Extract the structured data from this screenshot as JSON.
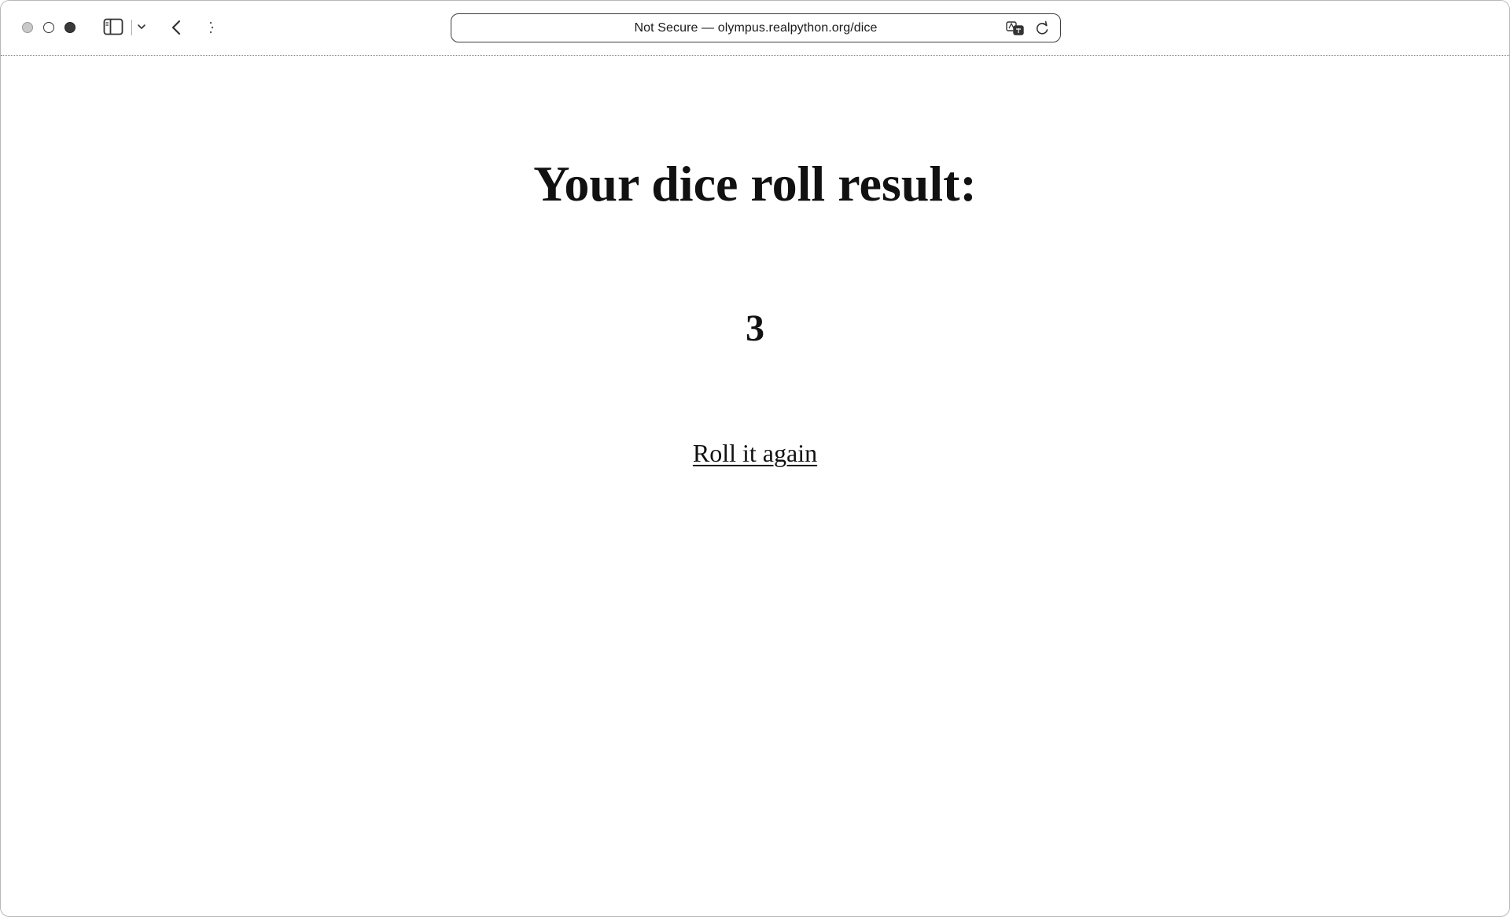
{
  "browser": {
    "address_bar": "Not Secure — olympus.realpython.org/dice"
  },
  "page": {
    "heading": "Your dice roll result:",
    "result": "3",
    "link_label": "Roll it again"
  },
  "icons": {
    "sidebar": "sidebar-icon",
    "chevron": "chevron-down-icon",
    "back": "back-arrow-icon",
    "forward": "forward-arrow-icon",
    "translate": "translate-icon",
    "reload": "reload-icon"
  },
  "colors": {
    "text": "#111111",
    "background": "#ffffff"
  }
}
